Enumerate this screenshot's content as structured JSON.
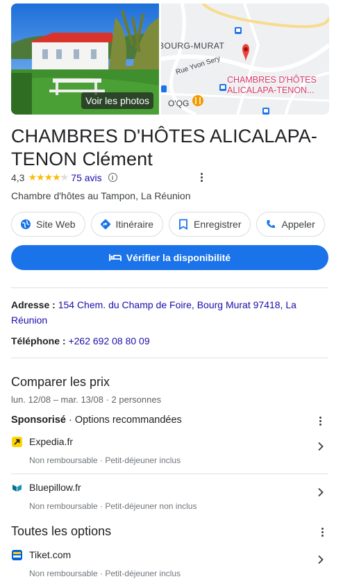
{
  "photo": {
    "label": "Voir les photos"
  },
  "map": {
    "area_label": "BOURG-MURAT",
    "street_label": "Rue Yvon Sery",
    "poi_label": "O'QG",
    "place_label_line1": "CHAMBRES D'HÔTES",
    "place_label_line2": "ALICALAPA-TENON..."
  },
  "business": {
    "title_line1": "CHAMBRES D'HÔTES ALICALAPA-",
    "title_line2": "TENON Clément",
    "rating": "4,3",
    "rating_value": 4.3,
    "stars": "★★★★★",
    "reviews": "75 avis",
    "category": "Chambre d'hôtes au Tampon, La Réunion"
  },
  "actions": {
    "website": "Site Web",
    "directions": "Itinéraire",
    "save": "Enregistrer",
    "call": "Appeler",
    "availability": "Vérifier la disponibilité"
  },
  "details": {
    "address_label": "Adresse :",
    "address_value": "154 Chem. du Champ de Foire, Bourg Murat 97418, La Réunion",
    "phone_label": "Téléphone :",
    "phone_value": "+262 692 08 80 09"
  },
  "prices": {
    "heading": "Comparer les prix",
    "dates": "lun. 12/08 – mar. 13/08 · 2 personnes",
    "sponsored_label": "Sponsorisé",
    "sponsored_rest": " · Options recommandées",
    "offers": [
      {
        "name": "Expedia.fr",
        "details": "Non remboursable · Petit-déjeuner inclus"
      },
      {
        "name": "Bluepillow.fr",
        "details": "Non remboursable · Petit-déjeuner non inclus"
      }
    ],
    "all_heading": "Toutes les options",
    "all_offers": [
      {
        "name": "Tiket.com",
        "details": "Non remboursable · Petit-déjeuner inclus"
      }
    ]
  },
  "colors": {
    "primary": "#1a73e8",
    "link": "#1a0dab",
    "star": "#fbbc04",
    "map_pin": "#ea4335"
  }
}
